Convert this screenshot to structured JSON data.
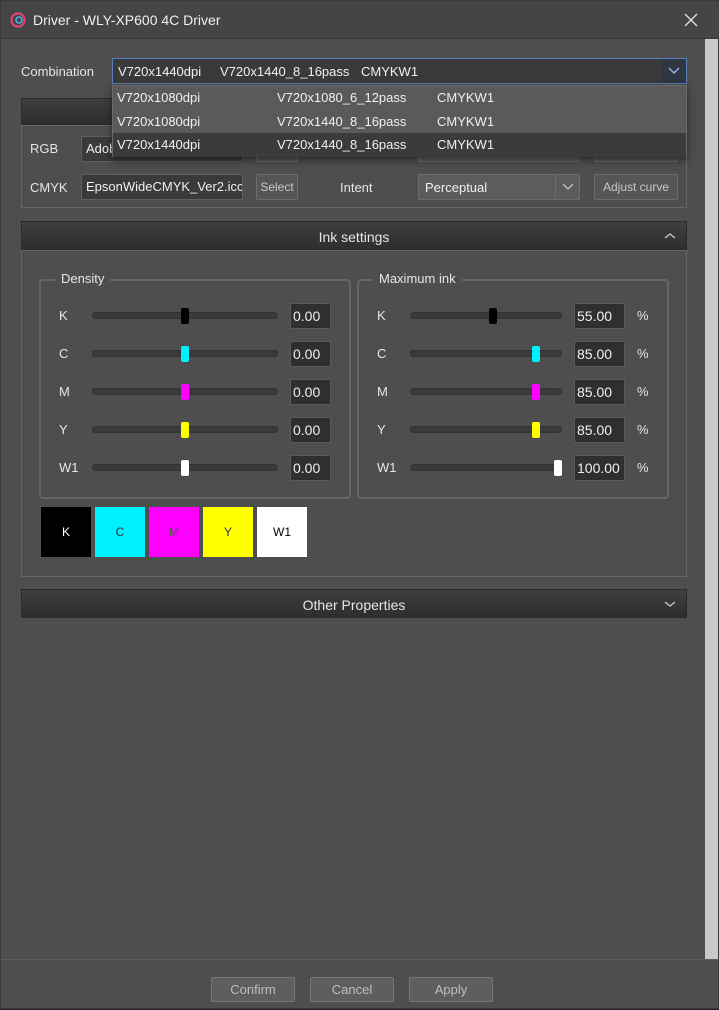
{
  "window": {
    "title": "Driver - WLY-XP600 4C Driver"
  },
  "combination": {
    "label": "Combination",
    "current": {
      "res": "V720x1440dpi",
      "mode": "V720x1440_8_16pass",
      "ink": "CMYKW1"
    },
    "options": [
      {
        "res": "V720x1080dpi",
        "mode": "V720x1080_6_12pass",
        "ink": "CMYKW1",
        "selected": false
      },
      {
        "res": "V720x1080dpi",
        "mode": "V720x1440_8_16pass",
        "ink": "CMYKW1",
        "selected": false
      },
      {
        "res": "V720x1440dpi",
        "mode": "V720x1440_8_16pass",
        "ink": "CMYKW1",
        "selected": true
      }
    ]
  },
  "color_profile": {
    "rgb_label": "RGB",
    "rgb_value": "Adob",
    "cmyk_label": "CMYK",
    "cmyk_value": "EpsonWideCMYK_Ver2.icc",
    "select_label": "Select",
    "intent_label": "Intent",
    "intent_value": "Perceptual",
    "adjust_curve_label": "Adjust curve"
  },
  "ink_settings": {
    "title": "Ink settings",
    "density": {
      "title": "Density",
      "rows": [
        {
          "label": "K",
          "value": "0.00",
          "level": 0.5,
          "color": "#000000"
        },
        {
          "label": "C",
          "value": "0.00",
          "level": 0.5,
          "color": "#00f0ff"
        },
        {
          "label": "M",
          "value": "0.00",
          "level": 0.5,
          "color": "#ff00ff"
        },
        {
          "label": "Y",
          "value": "0.00",
          "level": 0.5,
          "color": "#ffff00"
        },
        {
          "label": "W1",
          "value": "0.00",
          "level": 0.5,
          "color": "#ffffff"
        }
      ]
    },
    "max_ink": {
      "title": "Maximum ink",
      "unit": "%",
      "rows": [
        {
          "label": "K",
          "value": "55.00",
          "level": 0.55,
          "color": "#000000"
        },
        {
          "label": "C",
          "value": "85.00",
          "level": 0.85,
          "color": "#00f0ff"
        },
        {
          "label": "M",
          "value": "85.00",
          "level": 0.85,
          "color": "#ff00ff"
        },
        {
          "label": "Y",
          "value": "85.00",
          "level": 0.85,
          "color": "#ffff00"
        },
        {
          "label": "W1",
          "value": "100.00",
          "level": 1.0,
          "color": "#ffffff"
        }
      ]
    },
    "swatches": [
      {
        "label": "K",
        "bg": "#000000",
        "fg": "#ffffff"
      },
      {
        "label": "C",
        "bg": "#00f0ff",
        "fg": "#333333"
      },
      {
        "label": "M",
        "bg": "#ff00ff",
        "fg": "#555555"
      },
      {
        "label": "Y",
        "bg": "#ffff00",
        "fg": "#333333"
      },
      {
        "label": "W1",
        "bg": "#ffffff",
        "fg": "#000000"
      }
    ]
  },
  "other_properties": {
    "title": "Other Properties"
  },
  "footer": {
    "confirm": "Confirm",
    "cancel": "Cancel",
    "apply": "Apply"
  }
}
